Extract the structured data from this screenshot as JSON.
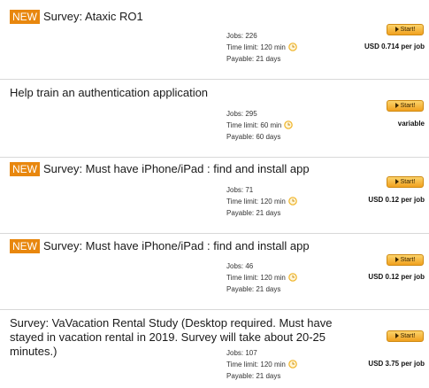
{
  "jobs": [
    {
      "badge": "NEW",
      "title": "Survey: Ataxic RO1",
      "jobs_text": "Jobs: 226",
      "time_text": "Time limit: 120 min",
      "payable_text": "Payable: 21 days",
      "start_label": "Start!",
      "price": "USD 0.714 per job"
    },
    {
      "badge": "",
      "title": "Help train an authentication application",
      "jobs_text": "Jobs: 295",
      "time_text": "Time limit: 60 min",
      "payable_text": "Payable: 60 days",
      "start_label": "Start!",
      "price": "variable"
    },
    {
      "badge": "NEW",
      "title": "Survey: Must have iPhone/iPad : find and install app",
      "jobs_text": "Jobs: 71",
      "time_text": "Time limit: 120 min",
      "payable_text": "Payable: 21 days",
      "start_label": "Start!",
      "price": "USD 0.12 per job"
    },
    {
      "badge": "NEW",
      "title": "Survey: Must have iPhone/iPad : find and install app",
      "jobs_text": "Jobs: 46",
      "time_text": "Time limit: 120 min",
      "payable_text": "Payable: 21 days",
      "start_label": "Start!",
      "price": "USD 0.12 per job"
    },
    {
      "badge": "",
      "title": "Survey: VaVacation Rental Study (Desktop required. Must have stayed in vacation rental in 2019. Survey will take about 20-25 minutes.)",
      "jobs_text": "Jobs: 107",
      "time_text": "Time limit: 120 min",
      "payable_text": "Payable: 21 days",
      "start_label": "Start!",
      "price": "USD 3.75 per job"
    }
  ],
  "colors": {
    "badge": "#e8870e",
    "button": "#f1a11f",
    "clock": "#f0b429"
  },
  "icons": {
    "clock": "clock-icon",
    "start_arrow": "play-arrow-icon"
  }
}
